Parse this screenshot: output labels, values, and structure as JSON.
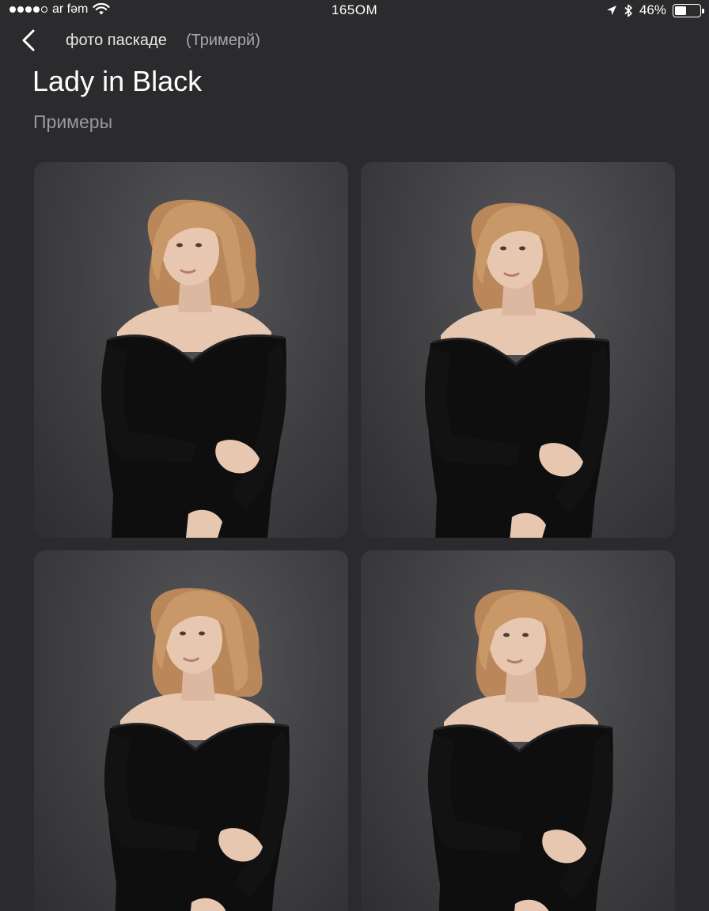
{
  "status_bar": {
    "carrier": "ar fəm",
    "time": "165OM",
    "battery_text": "46%",
    "battery_level": 0.46,
    "signal_bars_filled": 4,
    "signal_bars_total": 5
  },
  "nav": {
    "title": "фото паскаде",
    "subtitle": "(Тримерй)"
  },
  "header": {
    "title": "Lady in Black",
    "section_label": "Примеры"
  },
  "gallery": {
    "photos": [
      {
        "subject": "woman in black off-shoulder dress, looking left"
      },
      {
        "subject": "woman in black off-shoulder dress, looking left"
      },
      {
        "subject": "woman in black off-shoulder dress, looking left"
      },
      {
        "subject": "woman in black off-shoulder dress, looking left"
      }
    ]
  },
  "colors": {
    "background": "#2b2b2d",
    "photo_backdrop": "#434346",
    "dress": "#0e0e0f",
    "hair": "#b9875a",
    "skin": "#e8c7b0"
  }
}
